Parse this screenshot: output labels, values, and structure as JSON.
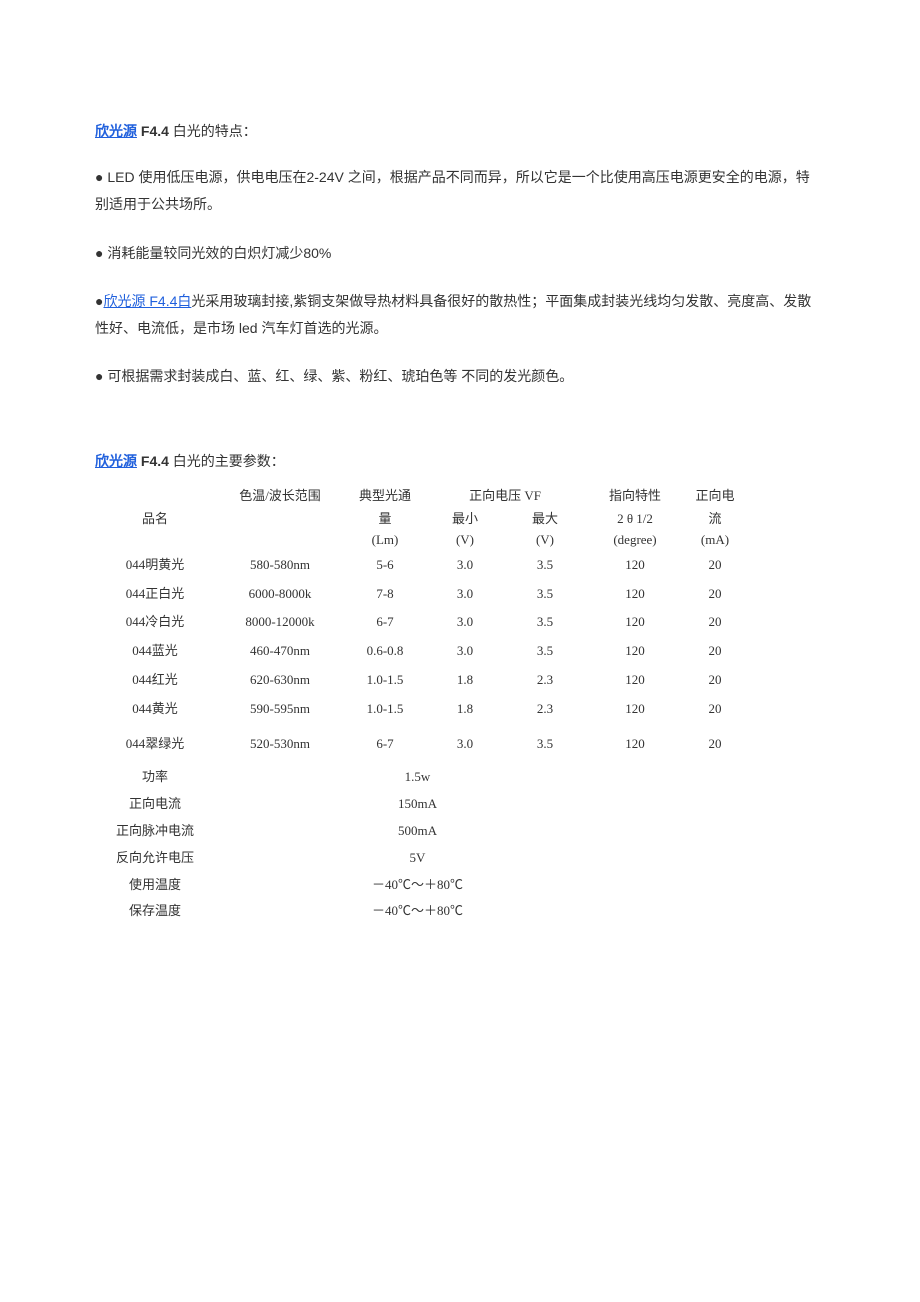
{
  "section1": {
    "link": "欣光源",
    "bold_suffix": " F4.4 ",
    "title_tail": "白光的特点：",
    "bullets": [
      {
        "plain_pre": "● LED 使用低压电源，供电电压在2-24V 之间，根据产品不同而异，所以它是一个比使用高压电源更安全的电源，特别适用于公共场所。"
      },
      {
        "plain_pre": "● 消耗能量较同光效的白炽灯减少80%"
      },
      {
        "prefix": "●",
        "link": "欣光源 F4.4白",
        "after": "光采用玻璃封接,紫铜支架做导热材料具备很好的散热性；平面集成封装光线均匀发散、亮度高、发散性好、电流低，是市场 led 汽车灯首选的光源。"
      },
      {
        "plain_pre": "● 可根据需求封装成白、蓝、红、绿、紫、粉红、琥珀色等 不同的发光颜色。"
      }
    ]
  },
  "section2": {
    "link": "欣光源",
    "bold_suffix": " F4.4 ",
    "title_tail": "白光的主要参数："
  },
  "headers": {
    "c1_top": "",
    "c1_mid": "品名",
    "c2_top": "色温/波长范围",
    "c3_top": "典型光通",
    "c3_mid": "量",
    "c3_sub": "(Lm)",
    "c4_mid": "最小",
    "c4_sub": "(V)",
    "c5_top": "正向电压 VF",
    "c5_mid": "最大",
    "c5_sub": "(V)",
    "c6_top": "指向特性",
    "c6_mid": "2 θ 1/2",
    "c6_sub": "(degree)",
    "c7_top": "正向电",
    "c7_mid": "流",
    "c7_sub": "(mA)"
  },
  "rows": [
    {
      "name": "044明黄光",
      "range": "580-580nm",
      "lm": "5-6",
      "vmin": "3.0",
      "vmax": "3.5",
      "deg": "120",
      "ma": "20"
    },
    {
      "name": "044正白光",
      "range": "6000-8000k",
      "lm": "7-8",
      "vmin": "3.0",
      "vmax": "3.5",
      "deg": "120",
      "ma": "20"
    },
    {
      "name": "044冷白光",
      "range": "8000-12000k",
      "lm": "6-7",
      "vmin": "3.0",
      "vmax": "3.5",
      "deg": "120",
      "ma": "20"
    },
    {
      "name": "044蓝光",
      "range": "460-470nm",
      "lm": "0.6-0.8",
      "vmin": "3.0",
      "vmax": "3.5",
      "deg": "120",
      "ma": "20"
    },
    {
      "name": "044红光",
      "range": "620-630nm",
      "lm": "1.0-1.5",
      "vmin": "1.8",
      "vmax": "2.3",
      "deg": "120",
      "ma": "20"
    },
    {
      "name": "044黄光",
      "range": "590-595nm",
      "lm": "1.0-1.5",
      "vmin": "1.8",
      "vmax": "2.3",
      "deg": "120",
      "ma": "20"
    },
    {
      "name": "044翠绿光",
      "range": "520-530nm",
      "lm": "6-7",
      "vmin": "3.0",
      "vmax": "3.5",
      "deg": "120",
      "ma": "20"
    }
  ],
  "specs": [
    {
      "label": "功率",
      "value": "1.5w"
    },
    {
      "label": "正向电流",
      "value": "150mA"
    },
    {
      "label": "正向脉冲电流",
      "value": "500mA"
    },
    {
      "label": "反向允许电压",
      "value": "5V"
    },
    {
      "label": "使用温度",
      "value": "－40℃～＋80℃"
    },
    {
      "label": "保存温度",
      "value": "－40℃～＋80℃"
    }
  ]
}
